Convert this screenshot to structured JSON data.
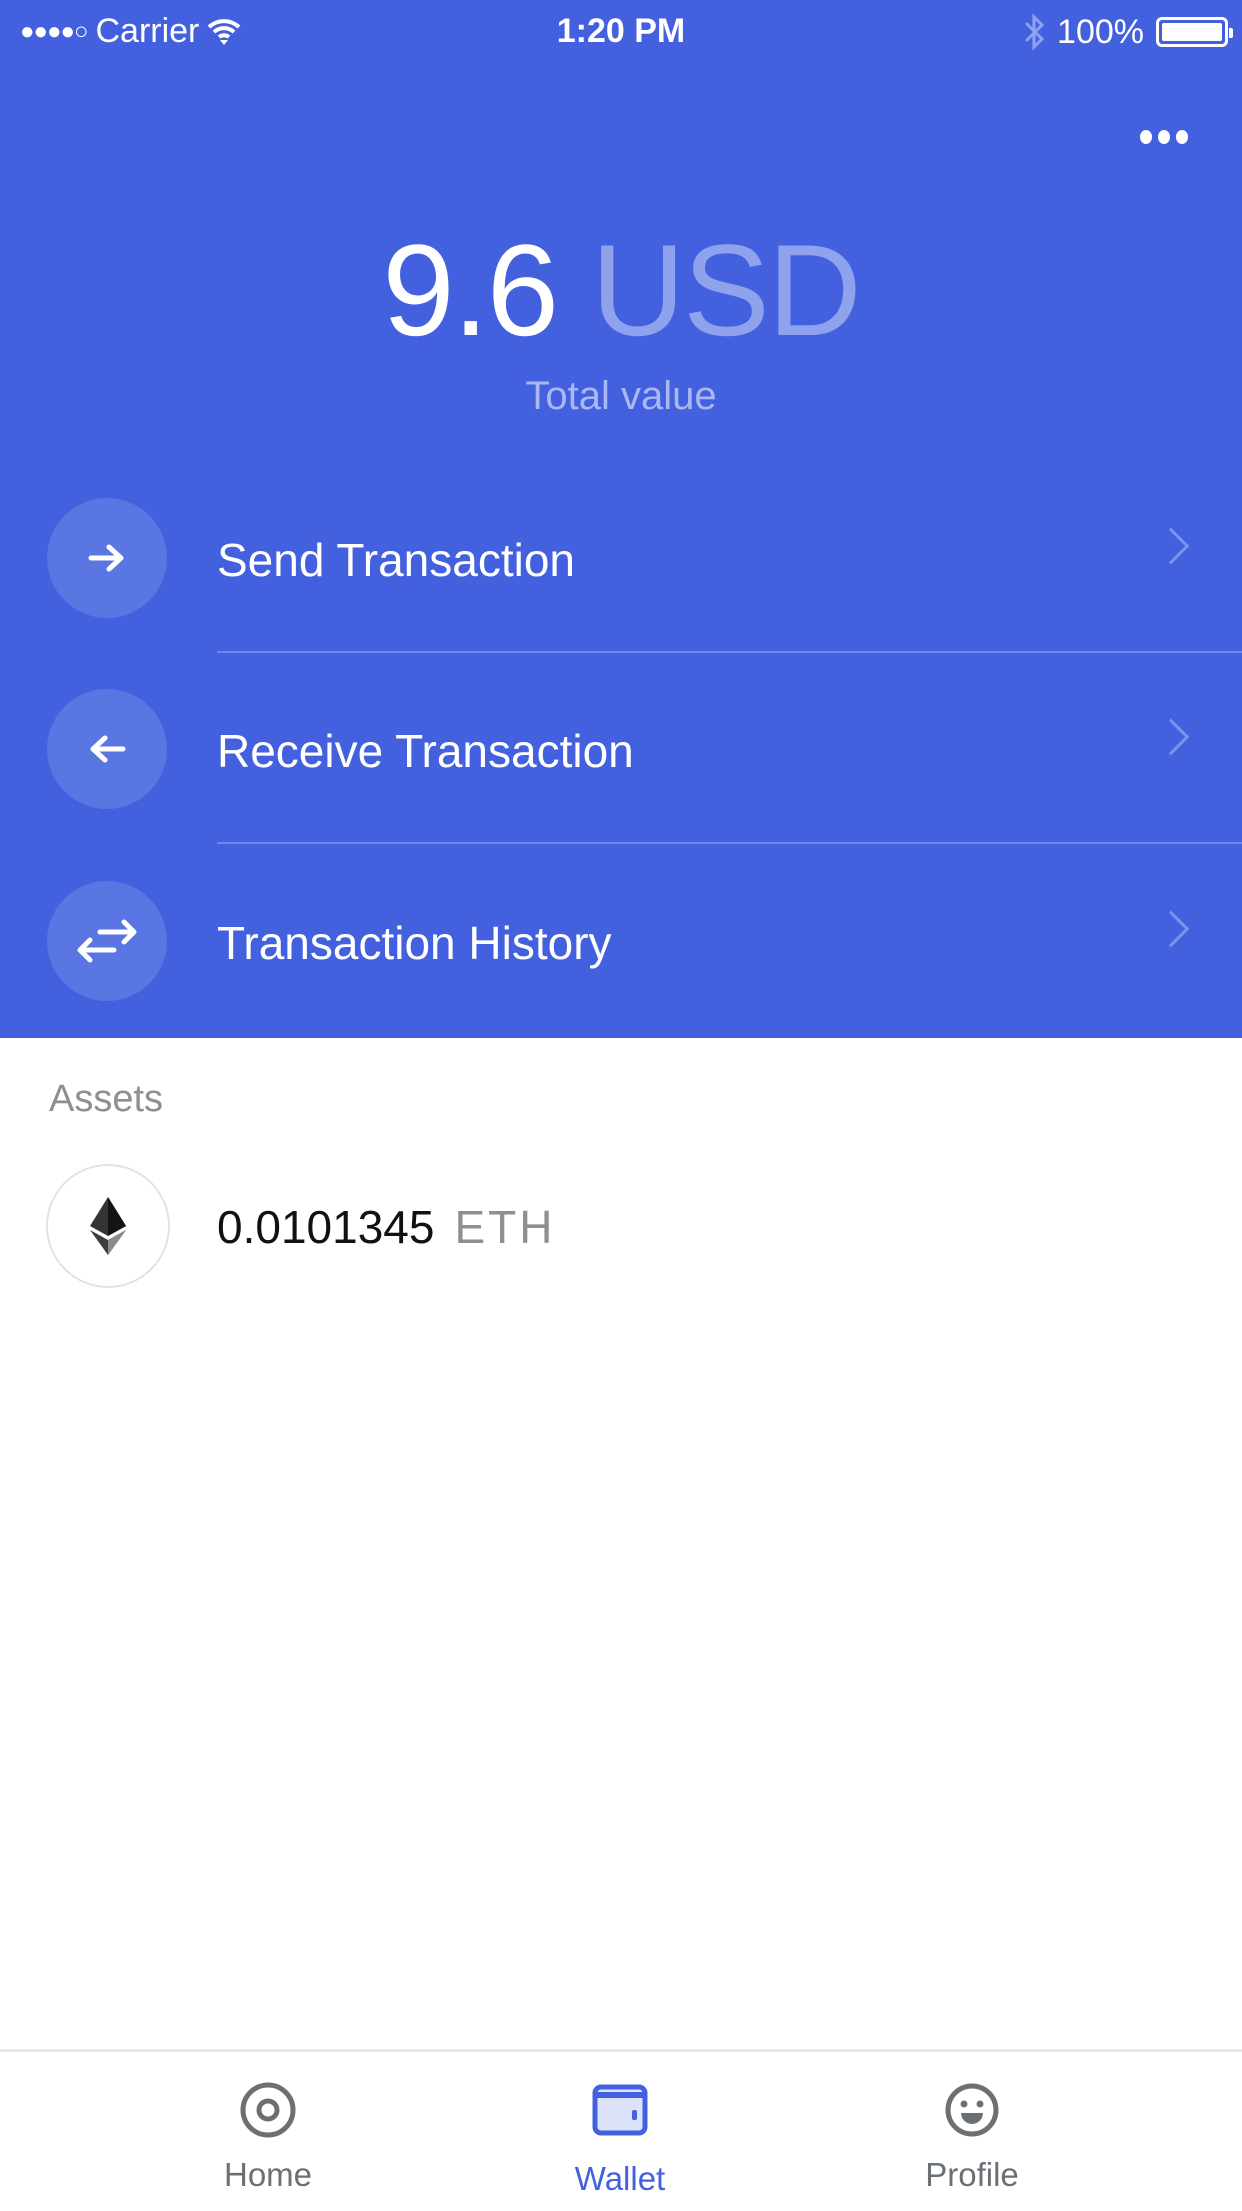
{
  "status_bar": {
    "carrier": "Carrier",
    "time": "1:20 PM",
    "battery": "100%"
  },
  "colors": {
    "accent": "#4361de",
    "muted": "#8e8e93"
  },
  "wallet": {
    "total_amount": "9.6",
    "total_currency": "USD",
    "total_label": "Total value"
  },
  "actions": [
    {
      "label": "Send Transaction",
      "icon": "arrow-right-icon"
    },
    {
      "label": "Receive Transaction",
      "icon": "arrow-left-icon"
    },
    {
      "label": "Transaction History",
      "icon": "swap-arrows-icon"
    }
  ],
  "assets": {
    "header": "Assets",
    "items": [
      {
        "amount": "0.0101345",
        "symbol": "ETH",
        "icon": "ethereum-icon"
      }
    ]
  },
  "tabs": [
    {
      "label": "Home",
      "icon": "target-icon"
    },
    {
      "label": "Wallet",
      "icon": "wallet-icon",
      "active": true
    },
    {
      "label": "Profile",
      "icon": "smiley-icon"
    }
  ]
}
